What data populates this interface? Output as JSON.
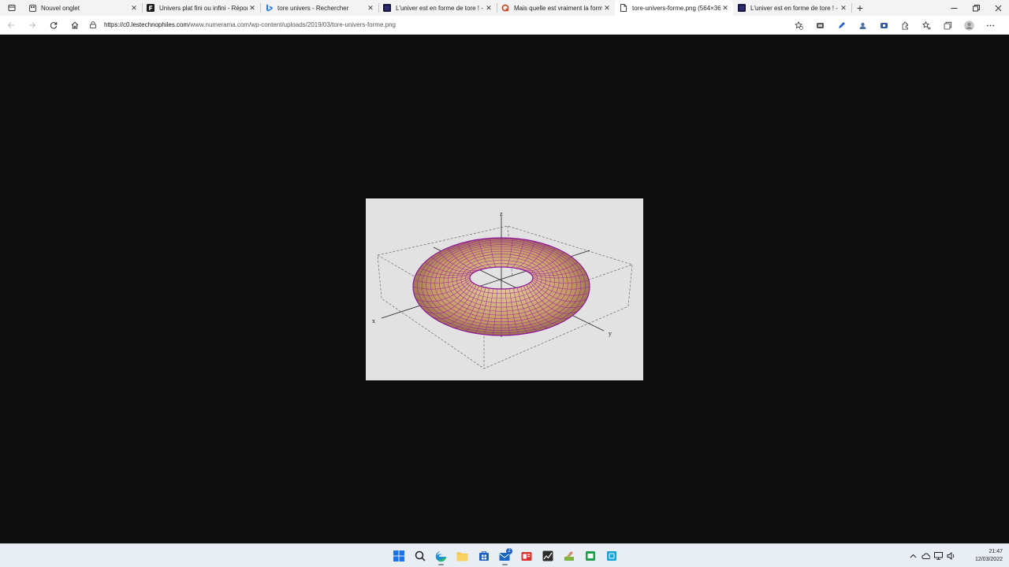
{
  "browser": {
    "tabs": [
      {
        "title": "Nouvel onglet",
        "favicon": "newtab-icon",
        "active": false
      },
      {
        "title": "Univers plat fini ou infini - Répor",
        "favicon": "futura-icon",
        "active": false
      },
      {
        "title": "tore univers - Rechercher",
        "favicon": "bing-icon",
        "active": false
      },
      {
        "title": "L'univer est en forme de tore ! -",
        "favicon": "site-icon",
        "active": false
      },
      {
        "title": "Mais quelle est vraiment la form",
        "favicon": "quora-icon",
        "active": false
      },
      {
        "title": "tore-univers-forme.png (564×36",
        "favicon": "file-icon",
        "active": true
      },
      {
        "title": "L'univer est en forme de tore ! -",
        "favicon": "site-icon",
        "active": false
      }
    ],
    "address": {
      "host": "https://c0.lestechnophiles.com",
      "path": "/www.numerama.com/wp-content/uploads/2019/03/tore-univers-forme.png"
    },
    "new_tab_glyph": "+",
    "close_glyph": "✕"
  },
  "image": {
    "axis_labels": {
      "x": "x",
      "y": "y",
      "z": "z"
    },
    "colors": {
      "surface": "#c9a06a",
      "mesh": "#9c1aa5",
      "background": "#e3e2e2"
    }
  },
  "taskbar": {
    "mail_badge": "2",
    "clock_time": "21:47",
    "clock_date": "12/03/2022"
  }
}
